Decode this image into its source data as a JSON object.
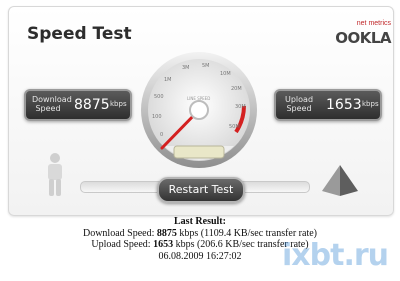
{
  "app": {
    "title": "Speed Test",
    "brand_small": "net metrics",
    "brand_name": "OOKLA"
  },
  "gauge": {
    "labels": [
      "0",
      "100",
      "500",
      "1M",
      "3M",
      "5M",
      "10M",
      "20M",
      "30M",
      "50M"
    ],
    "inner_label": "LINE SPEED",
    "accent_color": "#d42020"
  },
  "download": {
    "label_line1": "Download",
    "label_line2": "Speed",
    "value": "8875",
    "unit": "kbps"
  },
  "upload": {
    "label_line1": "Upload",
    "label_line2": "Speed",
    "value": "1653",
    "unit": "kbps"
  },
  "controls": {
    "restart_label": "Restart Test"
  },
  "result": {
    "heading": "Last Result:",
    "download_prefix": "Download Speed:",
    "download_value": "8875",
    "download_suffix": "kbps (1109.4 KB/sec transfer rate)",
    "upload_prefix": "Upload Speed:",
    "upload_value": "1653",
    "upload_suffix": "kbps (206.6 KB/sec transfer rate)",
    "timestamp": "06.08.2009 16:27:02"
  },
  "watermark": "ixbt.ru"
}
